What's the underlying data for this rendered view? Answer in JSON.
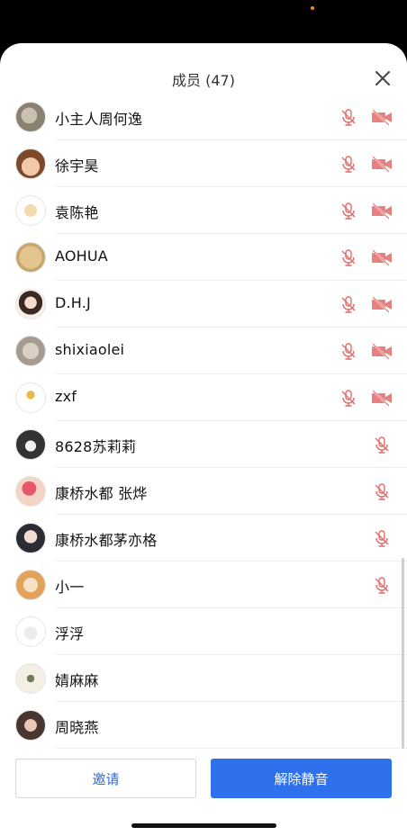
{
  "header": {
    "title": "成员 (47)"
  },
  "icons": {
    "close": "close-icon",
    "mic_muted": "mic-muted-icon",
    "camera_off": "camera-off-icon"
  },
  "colors": {
    "muted_red": "#e46a6a",
    "icon_gray": "#a0a0a0",
    "primary_blue": "#2f70ec",
    "invite_text": "#2b6be6"
  },
  "members": [
    {
      "name": "小主人周何逸",
      "mic": true,
      "cam": true
    },
    {
      "name": "徐宇昊",
      "mic": true,
      "cam": true
    },
    {
      "name": "袁陈艳",
      "mic": true,
      "cam": true
    },
    {
      "name": "AOHUA",
      "mic": true,
      "cam": true
    },
    {
      "name": "D.H.J",
      "mic": true,
      "cam": true
    },
    {
      "name": "shixiaolei",
      "mic": true,
      "cam": true
    },
    {
      "name": "zxf",
      "mic": true,
      "cam": true
    },
    {
      "name": "8628苏莉莉",
      "mic": true,
      "cam": false
    },
    {
      "name": "康桥水都 张烨",
      "mic": true,
      "cam": false
    },
    {
      "name": "康桥水都茅亦格",
      "mic": true,
      "cam": false
    },
    {
      "name": "小一",
      "mic": true,
      "cam": false
    },
    {
      "name": "浮浮",
      "mic": false,
      "cam": false
    },
    {
      "name": "婧麻麻",
      "mic": false,
      "cam": false
    },
    {
      "name": "周晓燕",
      "mic": false,
      "cam": false
    }
  ],
  "footer": {
    "invite_label": "邀请",
    "unmute_all_label": "解除静音"
  }
}
